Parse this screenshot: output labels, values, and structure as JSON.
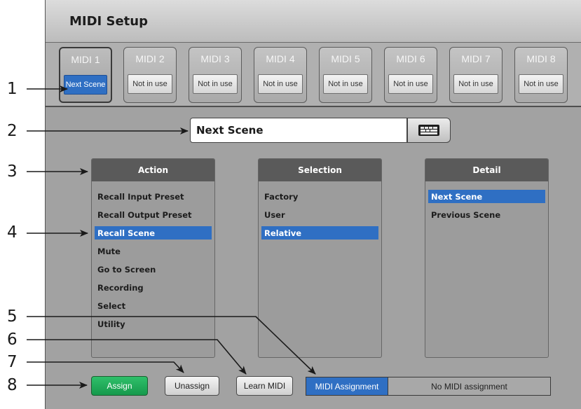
{
  "window": {
    "title": "MIDI Setup"
  },
  "midi_tabs": [
    {
      "label": "MIDI 1",
      "value": "Next Scene",
      "active": true
    },
    {
      "label": "MIDI 2",
      "value": "Not in use",
      "active": false
    },
    {
      "label": "MIDI 3",
      "value": "Not in use",
      "active": false
    },
    {
      "label": "MIDI 4",
      "value": "Not in use",
      "active": false
    },
    {
      "label": "MIDI 5",
      "value": "Not in use",
      "active": false
    },
    {
      "label": "MIDI 6",
      "value": "Not in use",
      "active": false
    },
    {
      "label": "MIDI 7",
      "value": "Not in use",
      "active": false
    },
    {
      "label": "MIDI 8",
      "value": "Not in use",
      "active": false
    }
  ],
  "name_field": {
    "value": "Next Scene",
    "button_icon": "keyboard-icon"
  },
  "action": {
    "header": "Action",
    "items": [
      "Recall Input Preset",
      "Recall Output Preset",
      "Recall Scene",
      "Mute",
      "Go to Screen",
      "Recording",
      "Select",
      "Utility"
    ],
    "selected": "Recall Scene"
  },
  "selection": {
    "header": "Selection",
    "items": [
      "Factory",
      "User",
      "Relative"
    ],
    "selected": "Relative"
  },
  "detail": {
    "header": "Detail",
    "items": [
      "Next Scene",
      "Previous Scene"
    ],
    "selected": "Next Scene"
  },
  "buttons": {
    "assign": "Assign",
    "unassign": "Unassign",
    "learn": "Learn MIDI"
  },
  "assignment": {
    "label": "MIDI Assignment",
    "value": "No MIDI assignment"
  },
  "callouts": [
    "1",
    "2",
    "3",
    "4",
    "5",
    "6",
    "7",
    "8"
  ],
  "colors": {
    "selection_blue": "#2f6fc3",
    "assign_green": "#1fa856",
    "panel_grey": "#a2a2a2",
    "header_grey": "#5a5a5a"
  }
}
